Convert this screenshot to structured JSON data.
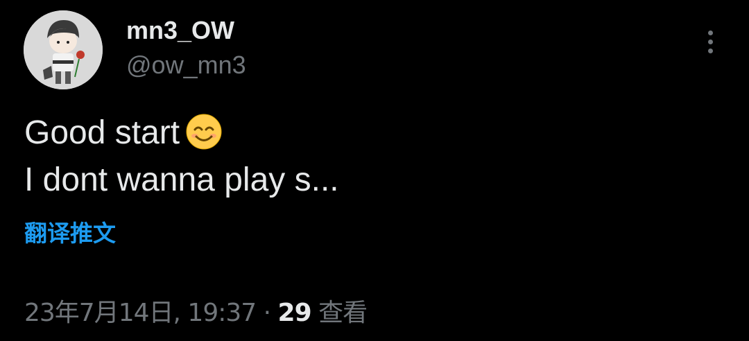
{
  "author": {
    "display_name": "mn3_OW",
    "handle": "@ow_mn3"
  },
  "tweet": {
    "line1": "Good start",
    "line1_emoji": "smiling-face-with-smiling-eyes-emoji",
    "line2": "I dont wanna play s..."
  },
  "translate_label": "翻译推文",
  "meta": {
    "date": "23年7月14日",
    "time": "19:37",
    "separator": "·",
    "views_count": "29",
    "views_label": "查看"
  },
  "icons": {
    "more": "more-vertical-icon",
    "avatar": "avatar-illustration"
  },
  "colors": {
    "background": "#000000",
    "primary_text": "#e7e9ea",
    "secondary_text": "#71767b",
    "accent": "#1d9bf0"
  }
}
